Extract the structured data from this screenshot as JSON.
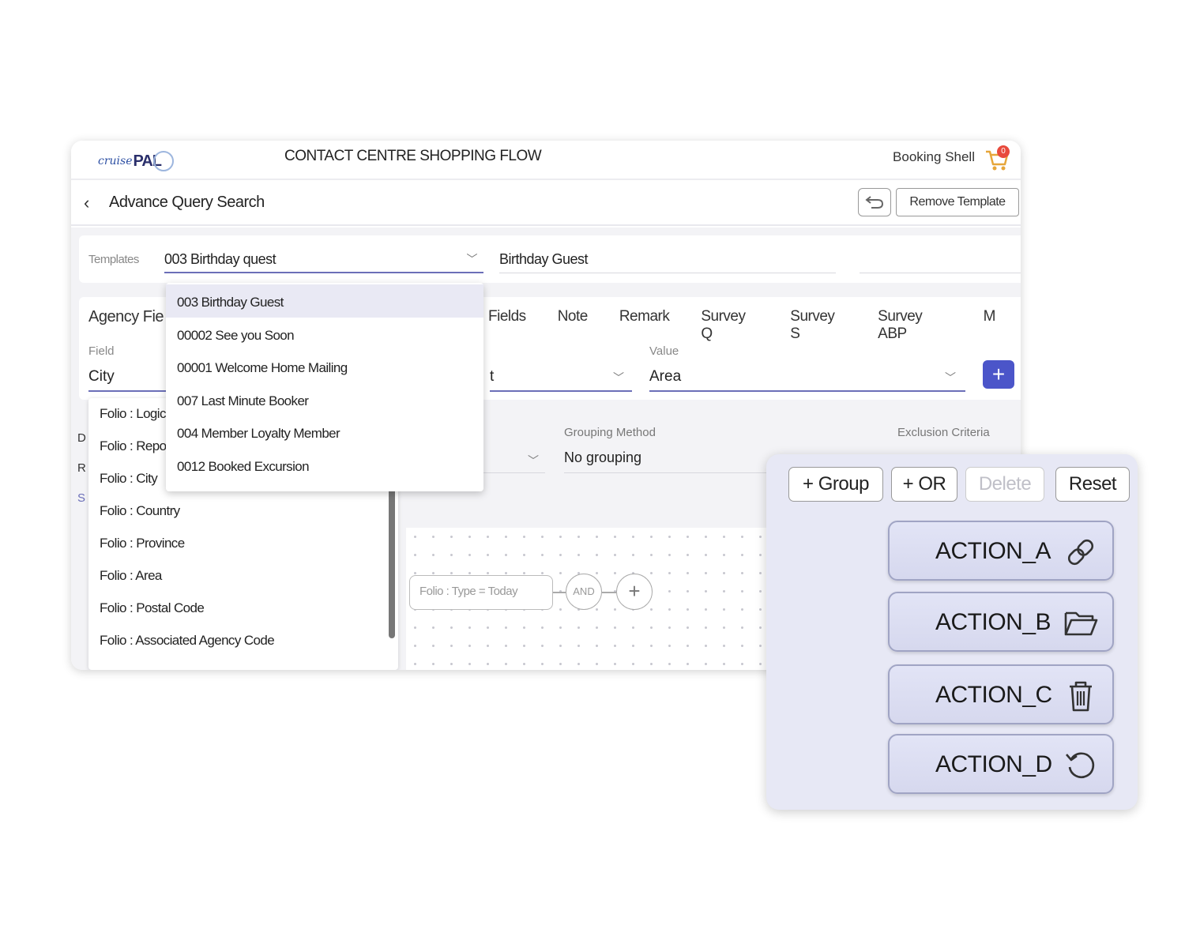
{
  "header": {
    "logo_prefix": "cruise",
    "logo_main": "PAL",
    "app_title": "CONTACT CENTRE SHOPPING FLOW",
    "booking_shell": "Booking Shell",
    "cart_count": "0"
  },
  "subheader": {
    "back_glyph": "‹",
    "title": "Advance Query Search",
    "remove_template": "Remove Template"
  },
  "templates": {
    "label": "Templates",
    "selected": "003 Birthday quest",
    "name_value": "Birthday Guest",
    "options": [
      "003 Birthday Guest",
      "00002 See you Soon",
      "00001 Welcome Home Mailing",
      "007 Last Minute Booker",
      "004 Member Loyalty Member",
      "0012 Booked Excursion"
    ]
  },
  "card": {
    "agency_label": "Agency Fie",
    "tabs": [
      "Fields",
      "Note",
      "Remark",
      "Survey Q",
      "Survey S",
      "Survey ABP",
      "M"
    ],
    "field_label": "Field",
    "field_value": "City",
    "operator_value": "t",
    "value_label": "Value",
    "value_value": "Area",
    "add_glyph": "+"
  },
  "grouping": {
    "method_label": "Grouping Method",
    "method_value": "No grouping",
    "exclusion_label": "Exclusion Criteria"
  },
  "field_list": [
    "Folio : Logic",
    "Folio : Repo",
    "Folio : City",
    "Folio : Country",
    "Folio : Province",
    "Folio : Area",
    "Folio : Postal Code",
    "Folio : Associated Agency Code"
  ],
  "side_letters": [
    "D",
    "R",
    "S"
  ],
  "query_canvas": {
    "node_text": "Folio : Type = Today",
    "and_label": "AND",
    "plus_glyph": "+"
  },
  "panel": {
    "group_btn": "+ Group",
    "or_btn": "+ OR",
    "delete_btn": "Delete",
    "reset_btn": "Reset",
    "actions": [
      {
        "label": "ACTION_A",
        "icon": "link-icon"
      },
      {
        "label": "ACTION_B",
        "icon": "folder-icon"
      },
      {
        "label": "ACTION_C",
        "icon": "trash-icon"
      },
      {
        "label": "ACTION_D",
        "icon": "refresh-icon"
      }
    ]
  },
  "colors": {
    "accent": "#4b55c9",
    "underline": "#6b6fb8",
    "badge": "#e84a3c",
    "panel_bg": "#e7e8f5"
  }
}
